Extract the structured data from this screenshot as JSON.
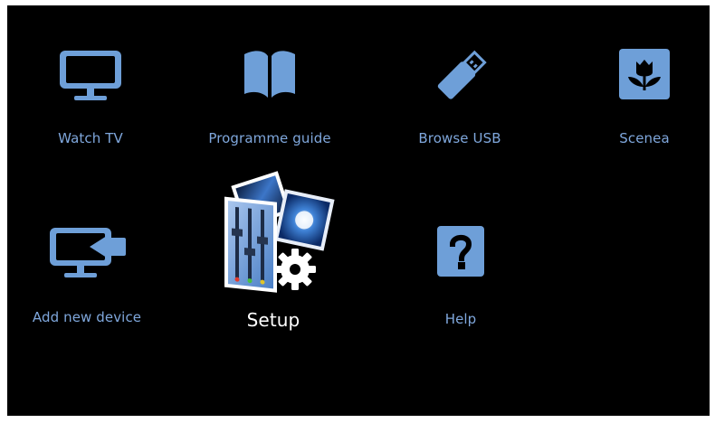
{
  "menu": {
    "items": [
      {
        "label": "Watch TV",
        "icon": "tv-icon",
        "selected": false
      },
      {
        "label": "Programme guide",
        "icon": "book-icon",
        "selected": false
      },
      {
        "label": "Browse USB",
        "icon": "usb-stick-icon",
        "selected": false
      },
      {
        "label": "Scenea",
        "icon": "flower-icon",
        "selected": false
      },
      {
        "label": "Add new device",
        "icon": "add-device-icon",
        "selected": false
      },
      {
        "label": "Setup",
        "icon": "setup-icon",
        "selected": true
      },
      {
        "label": "Help",
        "icon": "help-icon",
        "selected": false
      }
    ]
  },
  "colors": {
    "background": "#000000",
    "icon_blue": "#6e9fd8",
    "label_blue": "#7fa7dc",
    "selected_label": "#ffffff"
  }
}
